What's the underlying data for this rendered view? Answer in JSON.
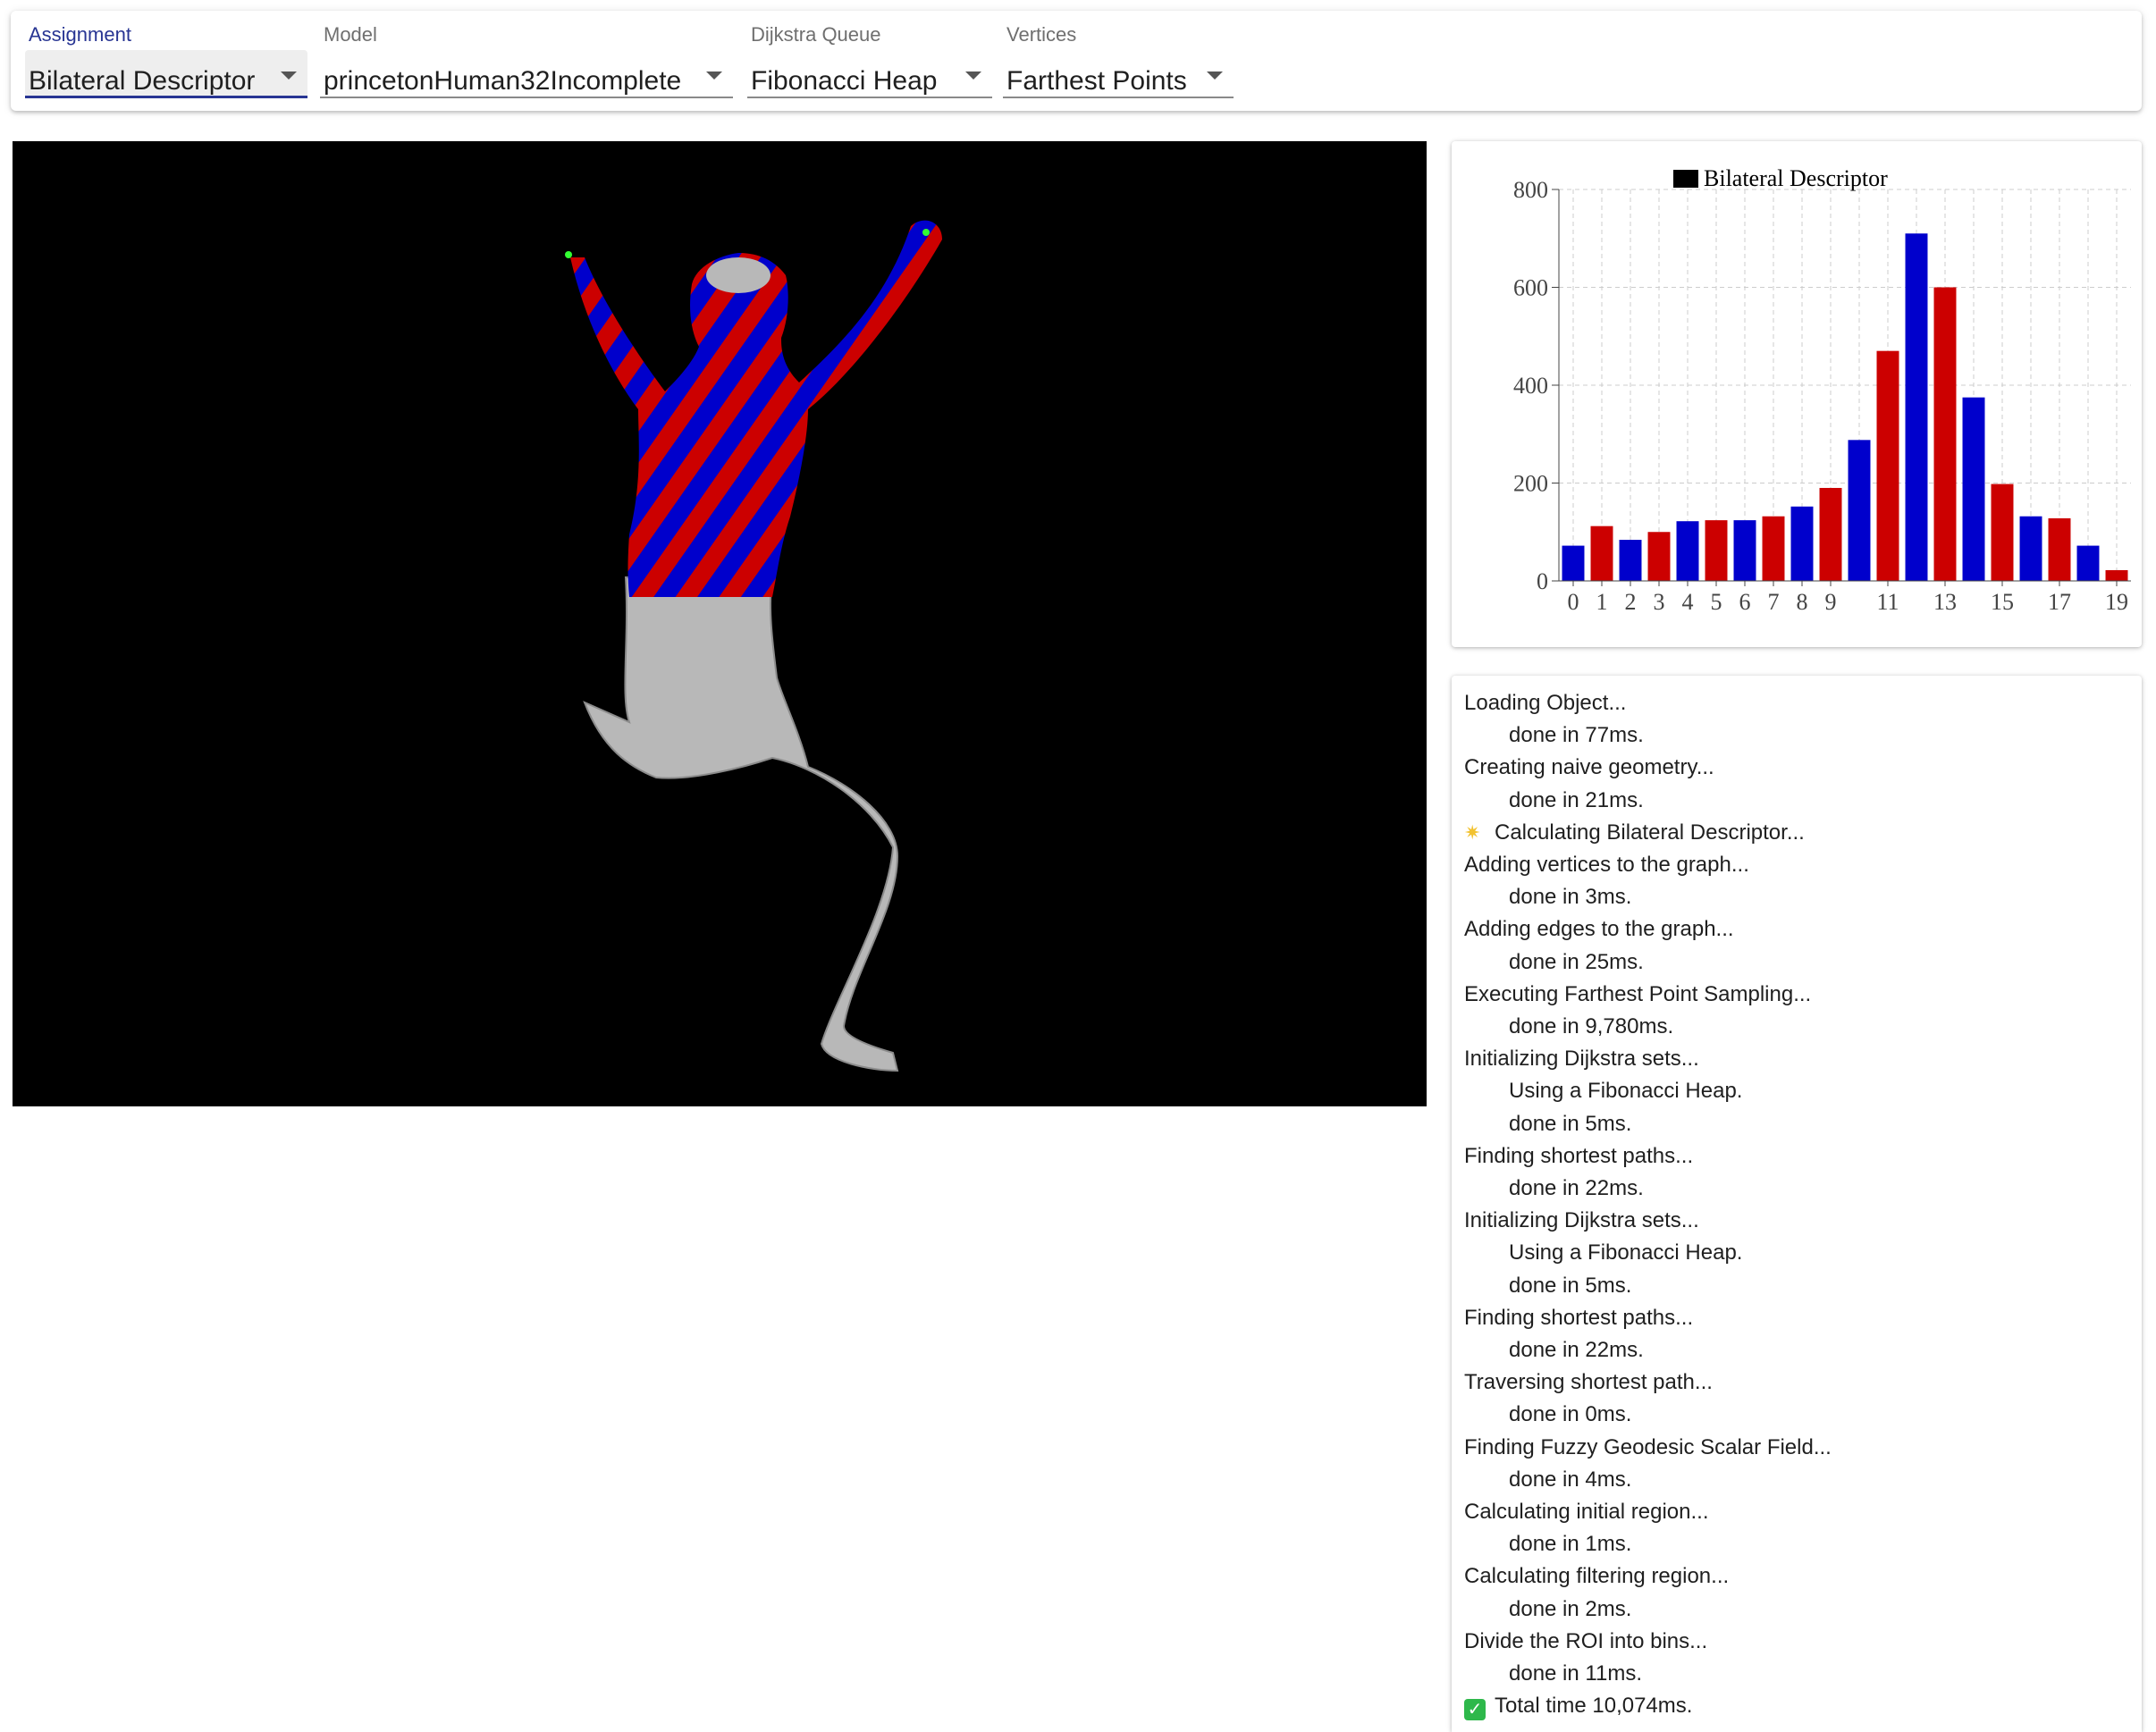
{
  "toolbar": {
    "assignment": {
      "label": "Assignment",
      "value": "Bilateral Descriptor"
    },
    "model": {
      "label": "Model",
      "value": "princetonHuman32Incomplete"
    },
    "queue": {
      "label": "Dijkstra Queue",
      "value": "Fibonacci Heap"
    },
    "vertices": {
      "label": "Vertices",
      "value": "Farthest Points"
    }
  },
  "colors": {
    "accent": "#283593",
    "blue": "#0000cc",
    "red": "#cc0000",
    "viewport_bg": "#000000",
    "mesh_gray": "#b8b8b8",
    "marker_green": "#33ff33"
  },
  "chart_data": {
    "type": "bar",
    "legend": "Bilateral Descriptor",
    "legend_placement": "top-center",
    "categories": [
      "0",
      "1",
      "2",
      "3",
      "4",
      "5",
      "6",
      "7",
      "8",
      "9",
      "10",
      "11",
      "12",
      "13",
      "14",
      "15",
      "16",
      "17",
      "18",
      "19"
    ],
    "tick_labels": [
      "0",
      "1",
      "2",
      "3",
      "4",
      "5",
      "6",
      "7",
      "8",
      "9",
      "11",
      "13",
      "15",
      "17",
      "19"
    ],
    "values": [
      72,
      112,
      84,
      100,
      122,
      124,
      124,
      132,
      152,
      190,
      288,
      470,
      710,
      600,
      375,
      198,
      132,
      128,
      72,
      22
    ],
    "bar_colors": [
      "blue",
      "red",
      "blue",
      "red",
      "blue",
      "red",
      "blue",
      "red",
      "blue",
      "red",
      "blue",
      "red",
      "blue",
      "red",
      "blue",
      "red",
      "blue",
      "red",
      "blue",
      "red"
    ],
    "ylim": [
      0,
      800
    ],
    "yticks": [
      "0",
      "200",
      "400",
      "600",
      "800"
    ],
    "grid": true
  },
  "log": [
    {
      "text": "Loading Object...",
      "indent": false
    },
    {
      "text": "done in 77ms.",
      "indent": true
    },
    {
      "text": "Creating naive geometry...",
      "indent": false
    },
    {
      "text": "done in 21ms.",
      "indent": true
    },
    {
      "text": "Calculating Bilateral Descriptor...",
      "indent": false,
      "icon": "sparkle-icon"
    },
    {
      "text": "Adding vertices to the graph...",
      "indent": false
    },
    {
      "text": "done in 3ms.",
      "indent": true
    },
    {
      "text": "Adding edges to the graph...",
      "indent": false
    },
    {
      "text": "done in 25ms.",
      "indent": true
    },
    {
      "text": "Executing Farthest Point Sampling...",
      "indent": false
    },
    {
      "text": "done in 9,780ms.",
      "indent": true
    },
    {
      "text": "Initializing Dijkstra sets...",
      "indent": false
    },
    {
      "text": "Using a Fibonacci Heap.",
      "indent": true
    },
    {
      "text": "done in 5ms.",
      "indent": true
    },
    {
      "text": "Finding shortest paths...",
      "indent": false
    },
    {
      "text": "done in 22ms.",
      "indent": true
    },
    {
      "text": "Initializing Dijkstra sets...",
      "indent": false
    },
    {
      "text": "Using a Fibonacci Heap.",
      "indent": true
    },
    {
      "text": "done in 5ms.",
      "indent": true
    },
    {
      "text": "Finding shortest paths...",
      "indent": false
    },
    {
      "text": "done in 22ms.",
      "indent": true
    },
    {
      "text": "Traversing shortest path...",
      "indent": false
    },
    {
      "text": "done in 0ms.",
      "indent": true
    },
    {
      "text": "Finding Fuzzy Geodesic Scalar Field...",
      "indent": false
    },
    {
      "text": "done in 4ms.",
      "indent": true
    },
    {
      "text": "Calculating initial region...",
      "indent": false
    },
    {
      "text": "done in 1ms.",
      "indent": true
    },
    {
      "text": "Calculating filtering region...",
      "indent": false
    },
    {
      "text": "done in 2ms.",
      "indent": true
    },
    {
      "text": "Divide the ROI into bins...",
      "indent": false
    },
    {
      "text": "done in 11ms.",
      "indent": true
    },
    {
      "text": "Total time 10,074ms.",
      "indent": false,
      "icon": "check-icon"
    }
  ]
}
